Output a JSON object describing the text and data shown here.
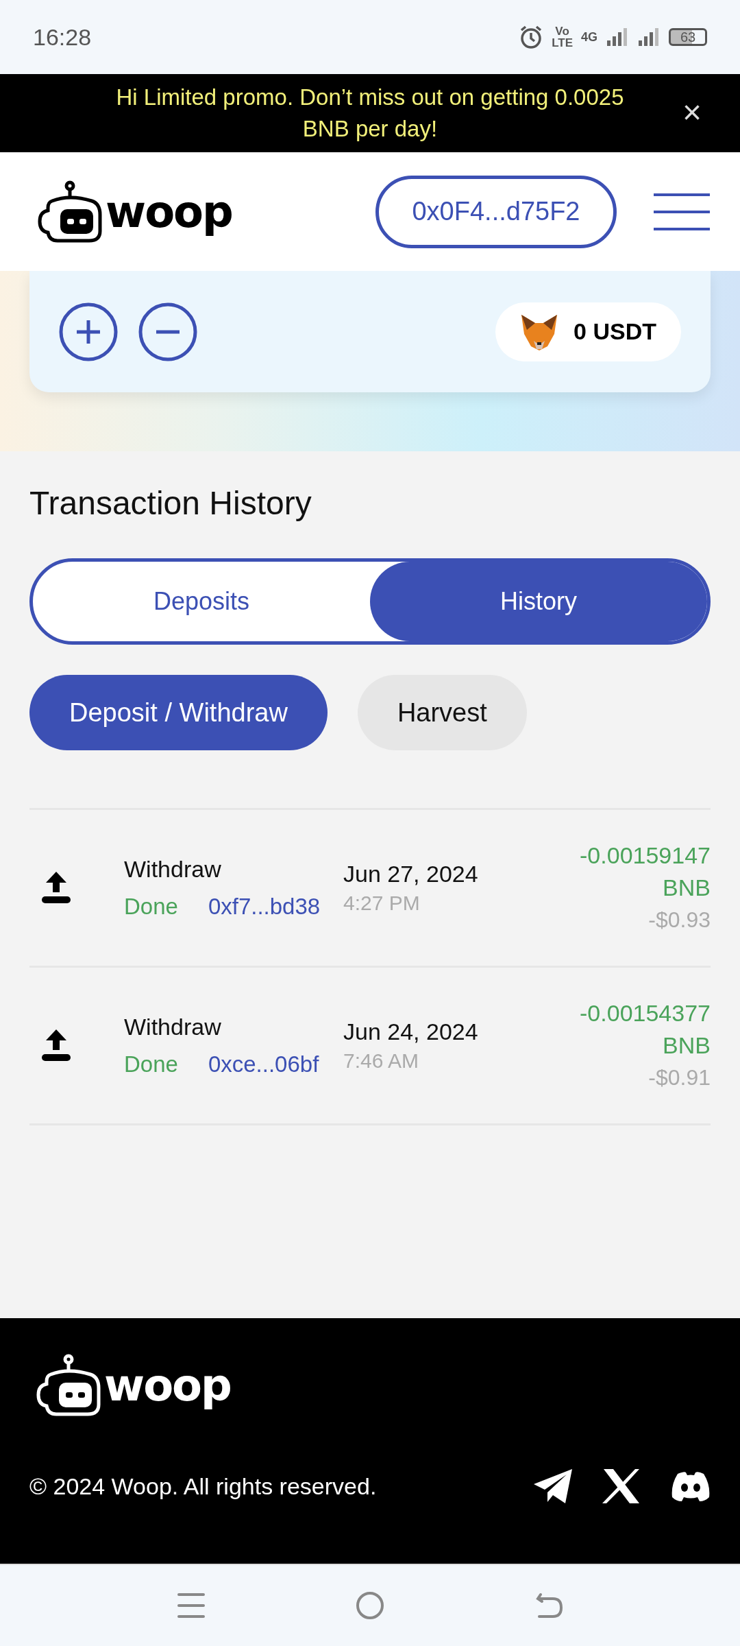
{
  "status_bar": {
    "time": "16:28",
    "volte_top": "Vo",
    "volte_bottom": "LTE",
    "network": "4G",
    "battery": "63"
  },
  "promo": {
    "text": "Hi Limited promo. Don’t miss out on getting 0.0025 BNB per day!",
    "close": "×"
  },
  "header": {
    "logo": "woop",
    "wallet": "0x0F4...d75F2"
  },
  "wallet_card": {
    "balance": "0 USDT"
  },
  "history": {
    "title": "Transaction History",
    "tabs": [
      {
        "label": "Deposits",
        "selected": false
      },
      {
        "label": "History",
        "selected": true
      }
    ],
    "filters": [
      {
        "label": "Deposit / Withdraw",
        "selected": true
      },
      {
        "label": "Harvest",
        "selected": false
      }
    ],
    "rows": [
      {
        "type": "Withdraw",
        "status": "Done",
        "hash": "0xf7...bd38",
        "date": "Jun 27, 2024",
        "time": "4:27 PM",
        "amount": "-0.00159147",
        "unit": "BNB",
        "usd": "-$0.93"
      },
      {
        "type": "Withdraw",
        "status": "Done",
        "hash": "0xce...06bf",
        "date": "Jun 24, 2024",
        "time": "7:46 AM",
        "amount": "-0.00154377",
        "unit": "BNB",
        "usd": "-$0.91"
      }
    ]
  },
  "footer": {
    "logo": "woop",
    "copyright": "© 2024 Woop. All rights reserved."
  }
}
